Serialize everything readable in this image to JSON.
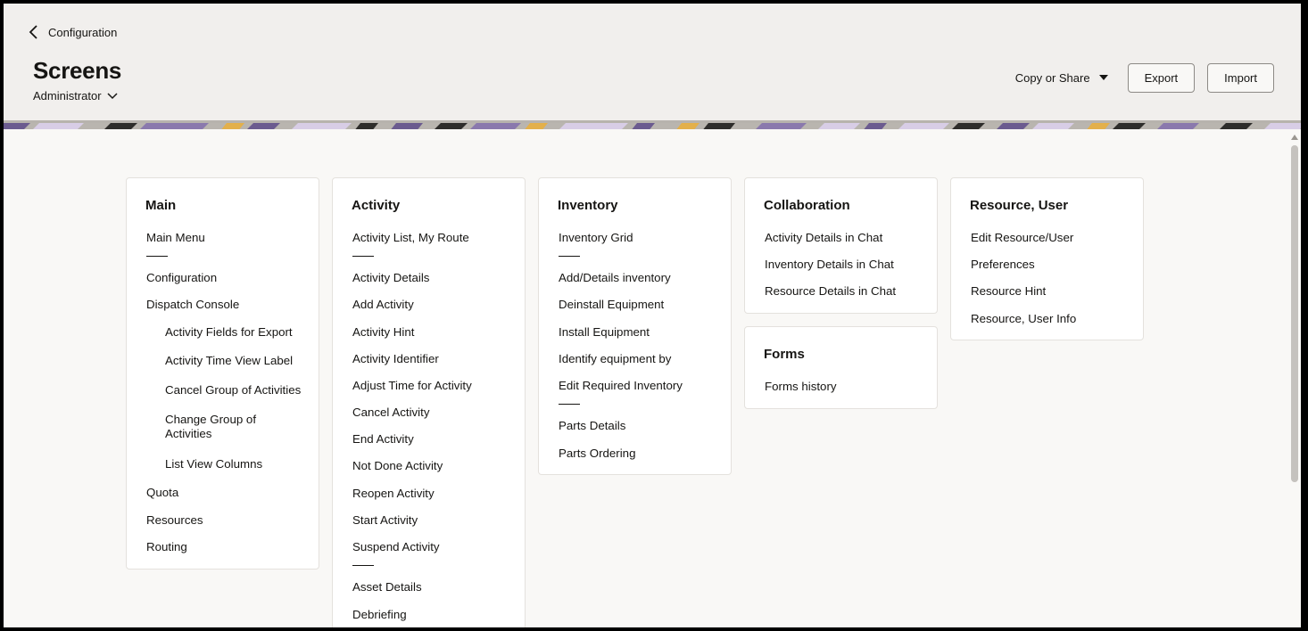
{
  "header": {
    "back_label": "Configuration",
    "title": "Screens",
    "role": "Administrator",
    "copy_share_label": "Copy or Share",
    "export_label": "Export",
    "import_label": "Import"
  },
  "cards": {
    "main": {
      "title": "Main",
      "items": [
        "Main Menu",
        "Configuration",
        "Dispatch Console",
        "Activity Fields for Export",
        "Activity Time View Label",
        "Cancel Group of Activities",
        "Change Group of Activities",
        "List View Columns",
        "Quota",
        "Resources",
        "Routing"
      ]
    },
    "activity": {
      "title": "Activity",
      "items": [
        "Activity List, My Route",
        "Activity Details",
        "Add Activity",
        "Activity Hint",
        "Activity Identifier",
        "Adjust Time for Activity",
        "Cancel Activity",
        "End Activity",
        "Not Done Activity",
        "Reopen Activity",
        "Start Activity",
        "Suspend Activity",
        "Asset Details",
        "Debriefing"
      ]
    },
    "inventory": {
      "title": "Inventory",
      "items": [
        "Inventory Grid",
        "Add/Details inventory",
        "Deinstall Equipment",
        "Install Equipment",
        "Identify equipment by",
        "Edit Required Inventory",
        "Parts Details",
        "Parts Ordering"
      ]
    },
    "collaboration": {
      "title": "Collaboration",
      "items": [
        "Activity Details in Chat",
        "Inventory Details in Chat",
        "Resource Details in Chat"
      ]
    },
    "forms": {
      "title": "Forms",
      "items": [
        "Forms history"
      ]
    },
    "resource_user": {
      "title": "Resource, User",
      "items": [
        "Edit Resource/User",
        "Preferences",
        "Resource Hint",
        "Resource, User Info"
      ]
    }
  }
}
